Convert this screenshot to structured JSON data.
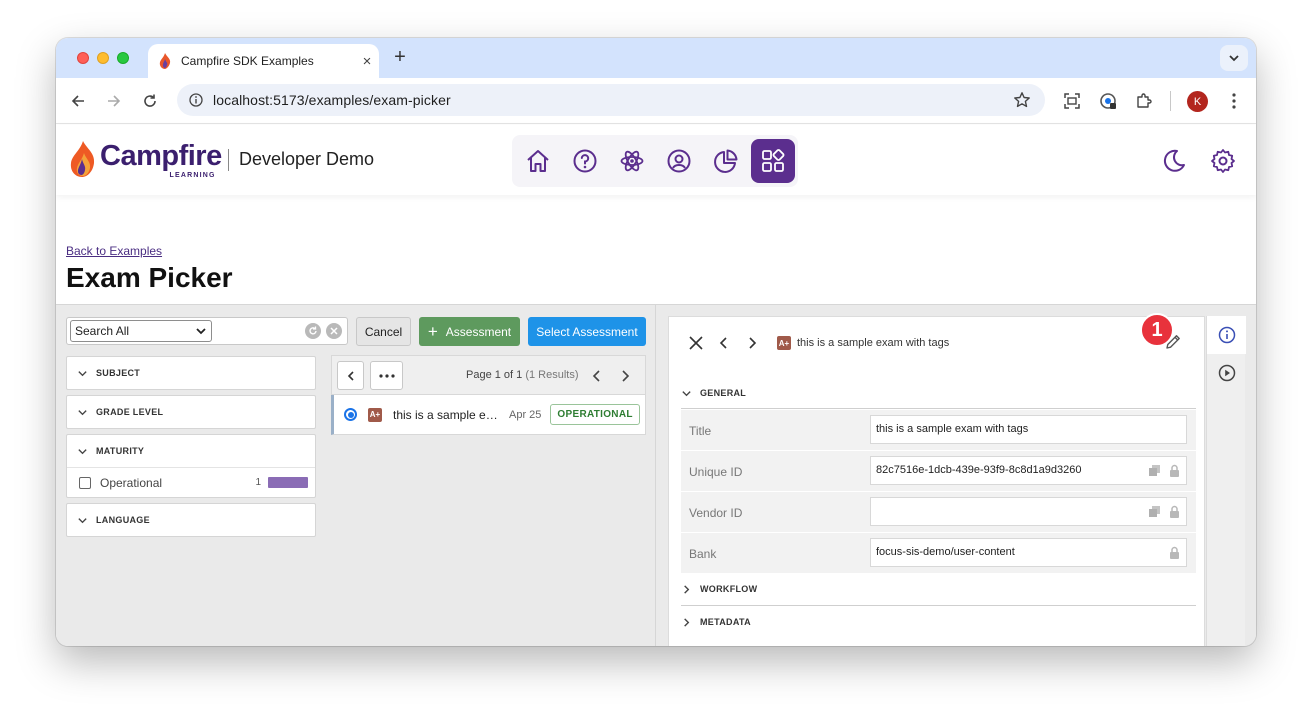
{
  "browser": {
    "tab_title": "Campfire SDK Examples",
    "tab_close": "×",
    "new_tab": "+",
    "url": "localhost:5173/examples/exam-picker",
    "profile_initial": "K"
  },
  "header": {
    "logo_text": "Campfire",
    "logo_sub": "LEARNING",
    "title": "Developer Demo",
    "nav_items": [
      {
        "name": "home",
        "icon": "home-icon"
      },
      {
        "name": "help",
        "icon": "help-circle-icon"
      },
      {
        "name": "atom",
        "icon": "atom-icon"
      },
      {
        "name": "user",
        "icon": "user-circle-icon"
      },
      {
        "name": "chart",
        "icon": "pie-chart-icon"
      },
      {
        "name": "examples",
        "icon": "apps-icon",
        "active": true
      }
    ]
  },
  "page": {
    "back_link": "Back to Examples",
    "title": "Exam Picker"
  },
  "search": {
    "scope_value": "Search All",
    "query": ""
  },
  "buttons": {
    "cancel": "Cancel",
    "assessment": "Assessment",
    "select_assessment": "Select Assessment"
  },
  "facets": [
    {
      "label": "SUBJECT",
      "expanded": false
    },
    {
      "label": "GRADE LEVEL",
      "expanded": false
    },
    {
      "label": "MATURITY",
      "expanded": true,
      "options": [
        {
          "label": "Operational",
          "count": "1"
        }
      ]
    },
    {
      "label": "LANGUAGE",
      "expanded": false
    }
  ],
  "results": {
    "page_text": "Page 1 of 1",
    "results_text": "(1 Results)",
    "items": [
      {
        "title": "this is a sample exam with tags",
        "date": "Apr 25",
        "status": "OPERATIONAL",
        "badge": "A+"
      }
    ]
  },
  "detail": {
    "title": "this is a sample exam with tags",
    "badge": "A+",
    "annotation_number": "1",
    "sections": {
      "general": "GENERAL",
      "workflow": "WORKFLOW",
      "metadata": "METADATA"
    },
    "fields": [
      {
        "label": "Title",
        "value": "this is a sample exam with tags"
      },
      {
        "label": "Unique ID",
        "value": "82c7516e-1dcb-439e-93f9-8c8d1a9d3260"
      },
      {
        "label": "Vendor ID",
        "value": ""
      },
      {
        "label": "Bank",
        "value": "focus-sis-demo/user-content"
      }
    ]
  },
  "colors": {
    "brand_purple": "#5b2e8e",
    "assessment_green": "#5e9a5e",
    "select_blue": "#1e93e8",
    "annotation_red": "#e8323c"
  }
}
